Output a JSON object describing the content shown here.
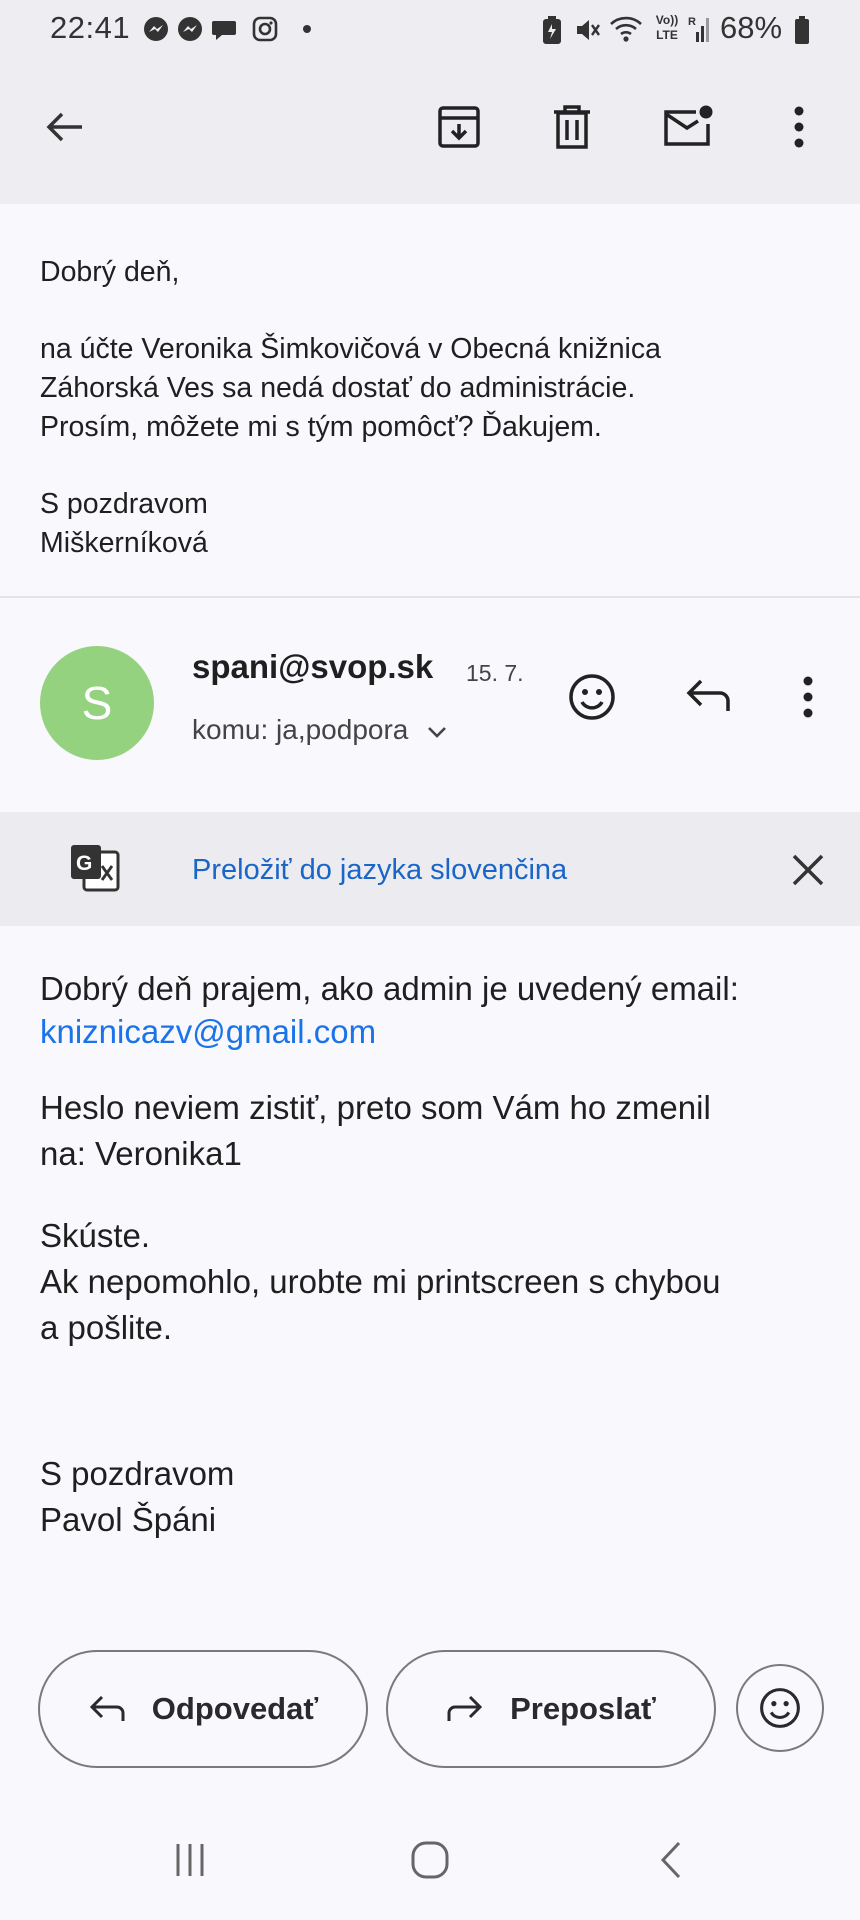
{
  "status_bar": {
    "time": "22:41",
    "battery": "68%",
    "icons": [
      "messenger-icon",
      "messenger-icon",
      "chat-bubble-icon",
      "instagram-icon",
      "dot-icon",
      "battery-saver-icon",
      "mute-icon",
      "wifi-icon",
      "volte-lte-icon",
      "signal-icon",
      "battery-icon"
    ],
    "network_label_top": "Vo))",
    "network_label_bottom": "LTE"
  },
  "toolbar": {
    "icons": [
      "back-arrow-icon",
      "archive-icon",
      "delete-icon",
      "mark-unread-icon",
      "more-vert-icon"
    ]
  },
  "quoted_message": {
    "greeting": "Dobrý deň,",
    "line1": "na účte Veronika Šimkovičová v Obecná knižnica",
    "line2": "Záhorská Ves sa nedá dostať do administrácie.",
    "line3": "Prosím, môžete mi s tým pomôcť? Ďakujem.",
    "closing": "S pozdravom",
    "signature": "Miškerníková"
  },
  "message": {
    "avatar_letter": "S",
    "avatar_color": "#95d27f",
    "sender": "spani@svop.sk",
    "date": "15. 7.",
    "recipients": "komu: ja,podpora",
    "translate_label": "Preložiť do jazyka slovenčina",
    "body_line1": "Dobrý deň prajem, ako admin je uvedený email:",
    "body_email": "kniznicazv@gmail.com",
    "body_line3": "Heslo neviem zistiť, preto som Vám ho zmenil",
    "body_line4": "na: Veronika1",
    "body_line5": "Skúste.",
    "body_line6": "Ak nepomohlo, urobte mi printscreen s chybou",
    "body_line7": "a pošlite.",
    "closing": "S pozdravom",
    "signature": "Pavol Špáni",
    "link_color": "#1a73e8"
  },
  "actions": {
    "reply_label": "Odpovedať",
    "forward_label": "Preposlať"
  },
  "nav_bar": {
    "icons": [
      "recent-apps-icon",
      "home-icon",
      "nav-back-icon"
    ]
  }
}
